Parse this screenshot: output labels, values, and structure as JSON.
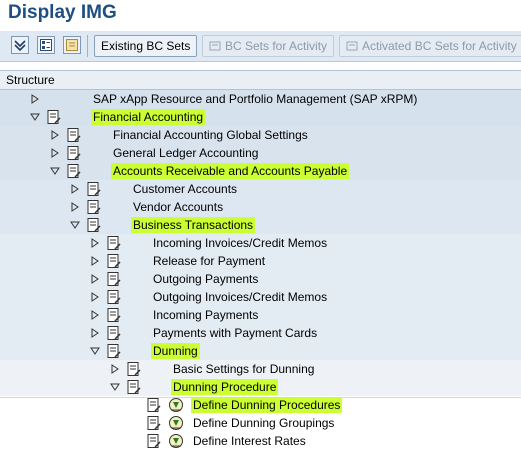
{
  "window": {
    "title": "Display IMG"
  },
  "toolbar": {
    "buttons": [
      {
        "label": "Existing BC Sets",
        "enabled": true
      },
      {
        "label": "BC Sets for Activity",
        "enabled": false
      },
      {
        "label": "Activated BC Sets for Activity",
        "enabled": false
      }
    ],
    "icons": [
      "expand-all-icon",
      "find-icon",
      "bookmark-icon"
    ]
  },
  "tree": {
    "header": "Structure",
    "nodes": [
      {
        "label": "SAP xApp Resource and Portfolio Management (SAP xRPM)",
        "expanded": false,
        "highlighted": false
      },
      {
        "label": "Financial Accounting",
        "expanded": true,
        "highlighted": true
      },
      {
        "label": "Financial Accounting Global Settings",
        "expanded": false,
        "highlighted": false
      },
      {
        "label": "General Ledger Accounting",
        "expanded": false,
        "highlighted": false
      },
      {
        "label": "Accounts Receivable and Accounts Payable",
        "expanded": true,
        "highlighted": true
      },
      {
        "label": "Customer Accounts",
        "expanded": false,
        "highlighted": false
      },
      {
        "label": "Vendor Accounts",
        "expanded": false,
        "highlighted": false
      },
      {
        "label": "Business Transactions",
        "expanded": true,
        "highlighted": true
      },
      {
        "label": "Incoming Invoices/Credit Memos",
        "expanded": false,
        "highlighted": false
      },
      {
        "label": "Release for Payment",
        "expanded": false,
        "highlighted": false
      },
      {
        "label": "Outgoing Payments",
        "expanded": false,
        "highlighted": false
      },
      {
        "label": "Outgoing Invoices/Credit Memos",
        "expanded": false,
        "highlighted": false
      },
      {
        "label": "Incoming Payments",
        "expanded": false,
        "highlighted": false
      },
      {
        "label": "Payments with Payment Cards",
        "expanded": false,
        "highlighted": false
      },
      {
        "label": "Dunning",
        "expanded": true,
        "highlighted": true
      },
      {
        "label": "Basic Settings for Dunning",
        "expanded": false,
        "highlighted": false
      },
      {
        "label": "Dunning Procedure",
        "expanded": true,
        "highlighted": true
      },
      {
        "label": "Define Dunning Procedures",
        "activity": true,
        "highlighted": true
      },
      {
        "label": "Define Dunning Groupings",
        "activity": true,
        "highlighted": false
      },
      {
        "label": "Define Interest Rates",
        "activity": true,
        "highlighted": false
      }
    ]
  },
  "colors": {
    "title": "#1f4f82",
    "highlight": "#ccff33",
    "toolbar_bg": "#dfe9f4"
  }
}
